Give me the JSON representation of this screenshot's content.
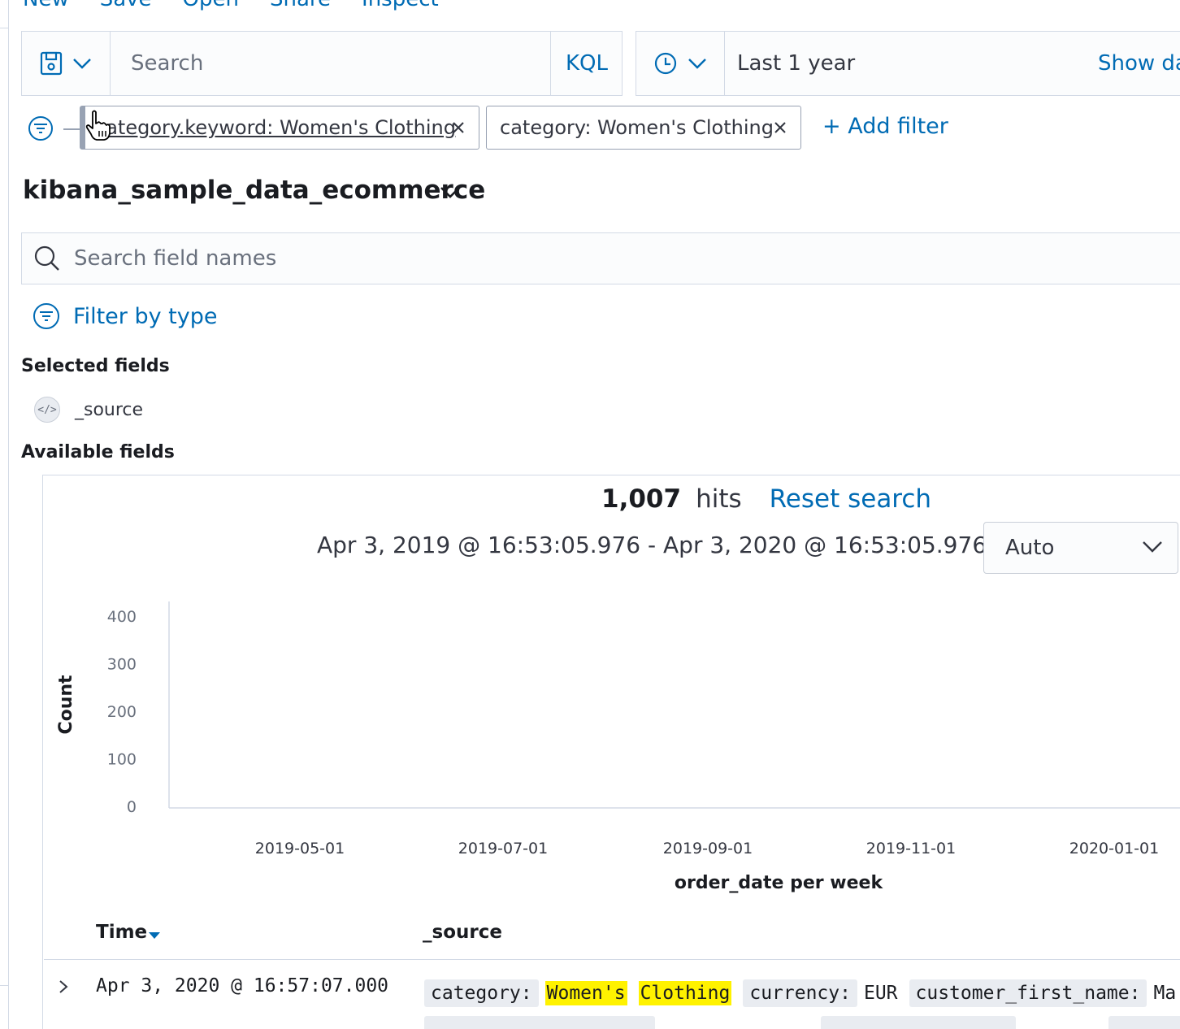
{
  "topnav": [
    "New",
    "Save",
    "Open",
    "Share",
    "Inspect"
  ],
  "query": {
    "search_placeholder": "Search",
    "language": "KQL"
  },
  "time": {
    "range_label": "Last 1 year",
    "show_dates": "Show dates"
  },
  "filters": {
    "pills": [
      {
        "label": "category.keyword: Women's Clothing"
      },
      {
        "label": "category: Women's Clothing"
      }
    ],
    "add_filter": "+ Add filter"
  },
  "sidebar": {
    "index_pattern": "kibana_sample_data_ecommerce",
    "field_search_placeholder": "Search field names",
    "filter_by_type": "Filter by type",
    "selected_fields_title": "Selected fields",
    "selected_fields": [
      {
        "name": "_source",
        "type_icon": "code-icon"
      }
    ],
    "available_fields_title": "Available fields"
  },
  "results": {
    "hits_count": "1,007",
    "hits_label": "hits",
    "reset_search": "Reset search",
    "date_range": "Apr 3, 2019 @ 16:53:05.976 - Apr 3, 2020 @ 16:53:05.976 —",
    "interval": "Auto"
  },
  "chart_data": {
    "type": "bar",
    "ylabel": "Count",
    "xlabel": "order_date per week",
    "ylim": [
      0,
      400
    ],
    "y_ticks": [
      "0",
      "100",
      "200",
      "300",
      "400"
    ],
    "x_ticks": [
      "2019-05-01",
      "2019-07-01",
      "2019-09-01",
      "2019-11-01",
      "2020-01-01"
    ],
    "series": [],
    "grid": false
  },
  "table": {
    "col_time": "Time",
    "col_source": "_source",
    "rows": [
      {
        "time": "Apr 3, 2020 @ 16:57:07.000",
        "fields": [
          {
            "key": "category:",
            "value_parts": [
              "Women's",
              "Clothing"
            ],
            "highlight": true
          },
          {
            "key": "currency:",
            "value": "EUR"
          },
          {
            "key": "customer_first_name:",
            "value": "Ma"
          }
        ]
      }
    ]
  },
  "colors": {
    "link": "#006bb4",
    "border": "#d3dae6",
    "highlight": "#fff200",
    "text": "#1a1c21"
  }
}
